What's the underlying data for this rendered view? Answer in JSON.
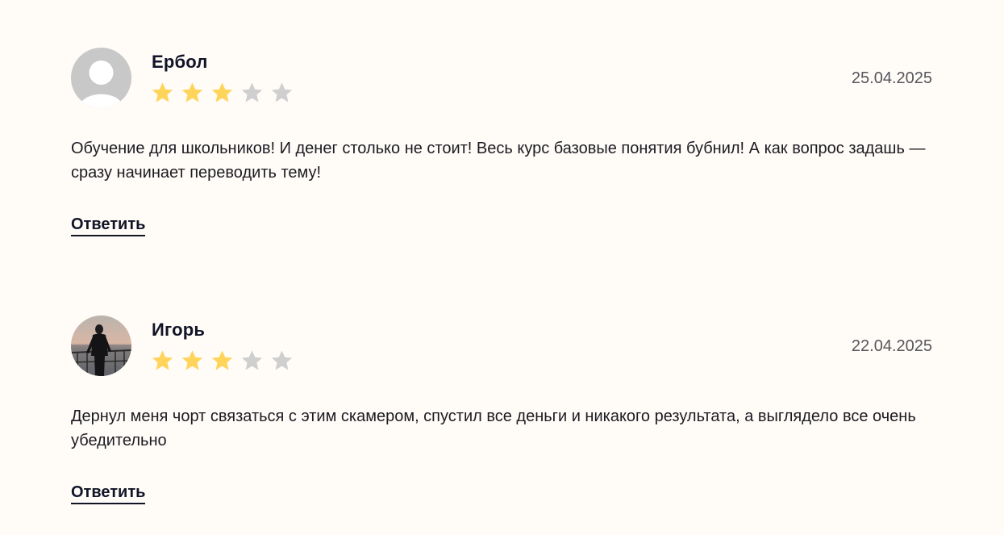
{
  "colors": {
    "background": "#fffbf7",
    "star_filled": "#ffd45a",
    "star_empty": "#cfcfcf",
    "text": "#1b1b22"
  },
  "reviews": [
    {
      "author": "Ербол",
      "date": "25.04.2025",
      "rating": 3,
      "rating_max": 5,
      "avatar": "default-user-icon",
      "text": "Обучение для школьников! И денег столько не стоит! Весь курс базовые понятия бубнил! А как вопрос задашь — сразу начинает переводить тему!",
      "reply_label": "Ответить"
    },
    {
      "author": "Игорь",
      "date": "22.04.2025",
      "rating": 3,
      "rating_max": 5,
      "avatar": "user-photo",
      "text": "Дернул меня чорт связаться с этим скамером, спустил все деньги и никакого результата, а выглядело все очень убедительно",
      "reply_label": "Ответить"
    }
  ]
}
